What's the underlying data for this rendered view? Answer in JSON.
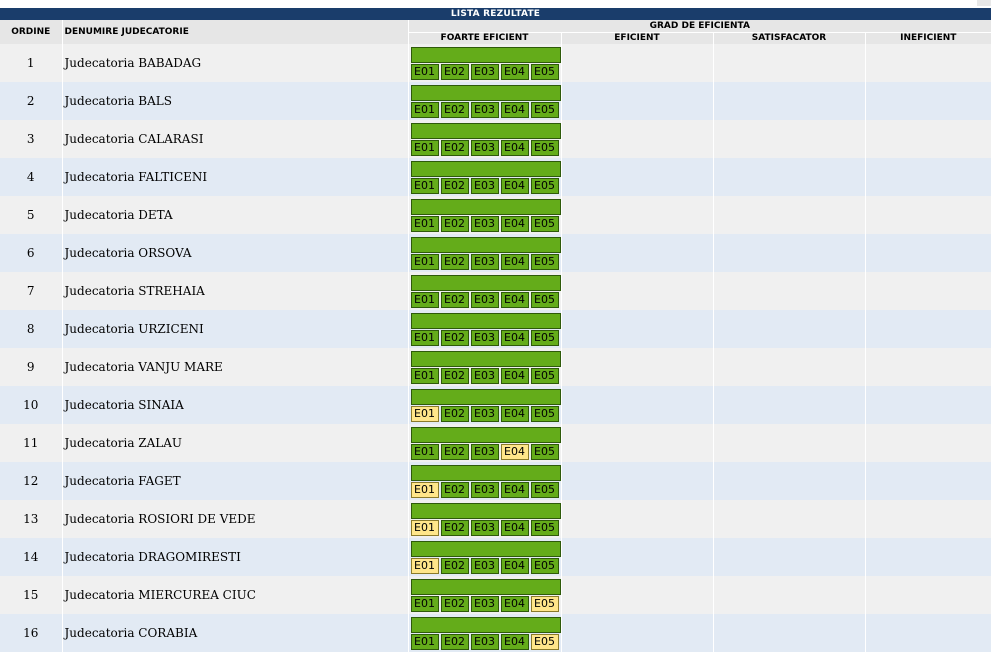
{
  "table": {
    "title": "LISTA REZULTATE",
    "headers": {
      "ordine": "ORDINE",
      "denumire": "DENUMIRE JUDECATORIE",
      "grad": "GRAD DE EFICIENTA",
      "foarte": "FOARTE EFICIENT",
      "eficient": "EFICIENT",
      "satisfacator": "SATISFACATOR",
      "ineficient": "INEFICIENT"
    },
    "colors": {
      "bar": "#64ac1a",
      "chip": "#64ac1a",
      "chip_highlight": "#ffe68a",
      "title_bg": "#1a3d6b"
    },
    "chip_labels": [
      "E01",
      "E02",
      "E03",
      "E04",
      "E05"
    ],
    "rows": [
      {
        "ordine": "1",
        "name": "Judecatoria BABADAG",
        "highlight": []
      },
      {
        "ordine": "2",
        "name": "Judecatoria BALS",
        "highlight": []
      },
      {
        "ordine": "3",
        "name": "Judecatoria CALARASI",
        "highlight": []
      },
      {
        "ordine": "4",
        "name": "Judecatoria FALTICENI",
        "highlight": []
      },
      {
        "ordine": "5",
        "name": "Judecatoria DETA",
        "highlight": []
      },
      {
        "ordine": "6",
        "name": "Judecatoria ORSOVA",
        "highlight": []
      },
      {
        "ordine": "7",
        "name": "Judecatoria STREHAIA",
        "highlight": []
      },
      {
        "ordine": "8",
        "name": "Judecatoria URZICENI",
        "highlight": []
      },
      {
        "ordine": "9",
        "name": "Judecatoria VANJU MARE",
        "highlight": []
      },
      {
        "ordine": "10",
        "name": "Judecatoria SINAIA",
        "highlight": [
          "E01"
        ]
      },
      {
        "ordine": "11",
        "name": "Judecatoria ZALAU",
        "highlight": [
          "E04"
        ]
      },
      {
        "ordine": "12",
        "name": "Judecatoria FAGET",
        "highlight": [
          "E01"
        ]
      },
      {
        "ordine": "13",
        "name": "Judecatoria ROSIORI DE VEDE",
        "highlight": [
          "E01"
        ]
      },
      {
        "ordine": "14",
        "name": "Judecatoria DRAGOMIRESTI",
        "highlight": [
          "E01"
        ]
      },
      {
        "ordine": "15",
        "name": "Judecatoria MIERCUREA CIUC",
        "highlight": [
          "E05"
        ]
      },
      {
        "ordine": "16",
        "name": "Judecatoria CORABIA",
        "highlight": [
          "E05"
        ]
      }
    ]
  }
}
